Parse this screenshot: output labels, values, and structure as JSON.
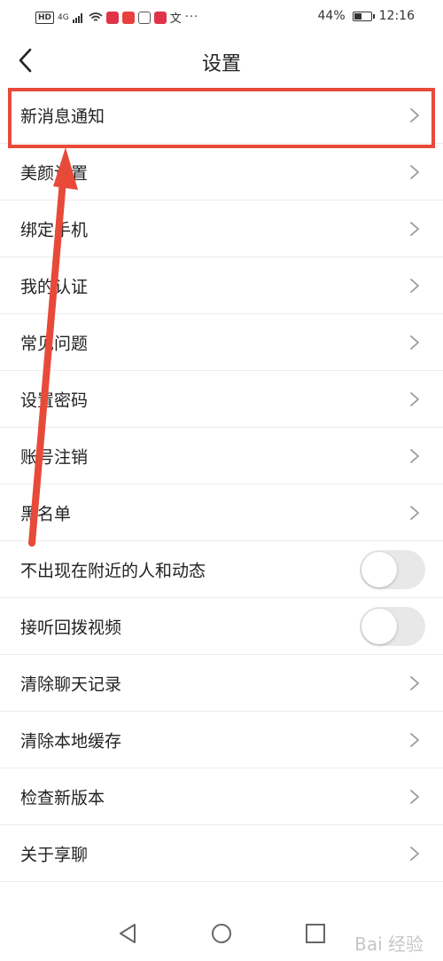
{
  "status_bar": {
    "network_badge": "HD",
    "network_type": "4G",
    "battery_percent": "44%",
    "battery_level": 0.44,
    "time": "12:16",
    "extra_glyph": "文"
  },
  "header": {
    "title": "设置"
  },
  "settings": [
    {
      "label": "新消息通知",
      "type": "nav"
    },
    {
      "label": "美颜设置",
      "type": "nav"
    },
    {
      "label": "绑定手机",
      "type": "nav"
    },
    {
      "label": "我的认证",
      "type": "nav"
    },
    {
      "label": "常见问题",
      "type": "nav"
    },
    {
      "label": "设置密码",
      "type": "nav"
    },
    {
      "label": "账号注销",
      "type": "nav"
    },
    {
      "label": "黑名单",
      "type": "nav"
    },
    {
      "label": "不出现在附近的人和动态",
      "type": "toggle",
      "on": false
    },
    {
      "label": "接听回拨视频",
      "type": "toggle",
      "on": false
    },
    {
      "label": "清除聊天记录",
      "type": "nav"
    },
    {
      "label": "清除本地缓存",
      "type": "nav"
    },
    {
      "label": "检查新版本",
      "type": "nav"
    },
    {
      "label": "关于享聊",
      "type": "nav"
    }
  ],
  "annotation": {
    "color": "#e84a3a"
  },
  "watermark": "Bai 经验"
}
